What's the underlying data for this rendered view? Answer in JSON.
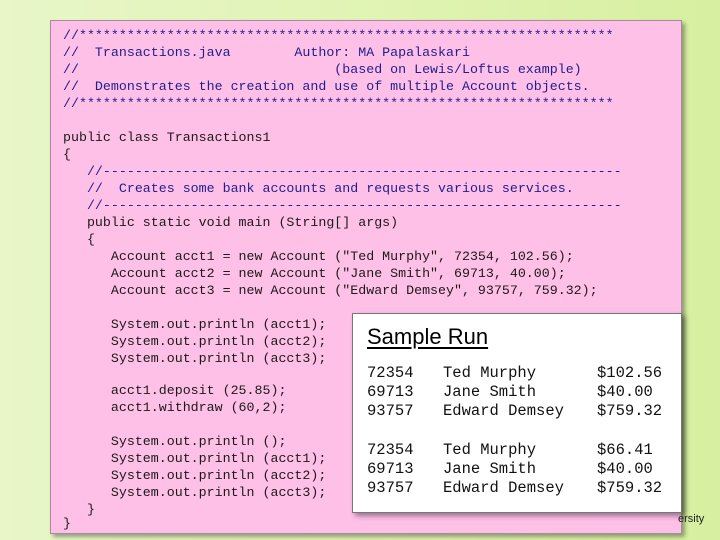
{
  "code": {
    "lines": [
      "//*******************************************************************",
      "//  Transactions.java        Author: MA Papalaskari",
      "//                                (based on Lewis/Loftus example)",
      "//  Demonstrates the creation and use of multiple Account objects.",
      "//*******************************************************************",
      "public class Transactions1",
      "{",
      "   //-----------------------------------------------------------------",
      "   //  Creates some bank accounts and requests various services.",
      "   //-----------------------------------------------------------------",
      "   public static void main (String[] args)",
      "   {",
      "      Account acct1 = new Account (\"Ted Murphy\", 72354, 102.56);",
      "      Account acct2 = new Account (\"Jane Smith\", 69713, 40.00);",
      "      Account acct3 = new Account (\"Edward Demsey\", 93757, 759.32);",
      "      System.out.println (acct1);",
      "      System.out.println (acct2);",
      "      System.out.println (acct3);",
      "      acct1.deposit (25.85);",
      "      acct1.withdraw (60,2);",
      "      System.out.println ();",
      "      System.out.println (acct1);",
      "      System.out.println (acct2);",
      "      System.out.println (acct3);",
      "   }",
      "}"
    ]
  },
  "sample_run": {
    "title": "Sample Run",
    "first_output": [
      {
        "id": "72354",
        "name": "Ted Murphy",
        "balance": "$102.56"
      },
      {
        "id": "69713",
        "name": "Jane Smith",
        "balance": "$40.00"
      },
      {
        "id": "93757",
        "name": "Edward Demsey",
        "balance": "$759.32"
      }
    ],
    "second_output": [
      {
        "id": "72354",
        "name": "Ted Murphy",
        "balance": "$66.41"
      },
      {
        "id": "69713",
        "name": "Jane Smith",
        "balance": "$40.00"
      },
      {
        "id": "93757",
        "name": "Edward Demsey",
        "balance": "$759.32"
      }
    ]
  },
  "footer": {
    "text": "ersity"
  }
}
